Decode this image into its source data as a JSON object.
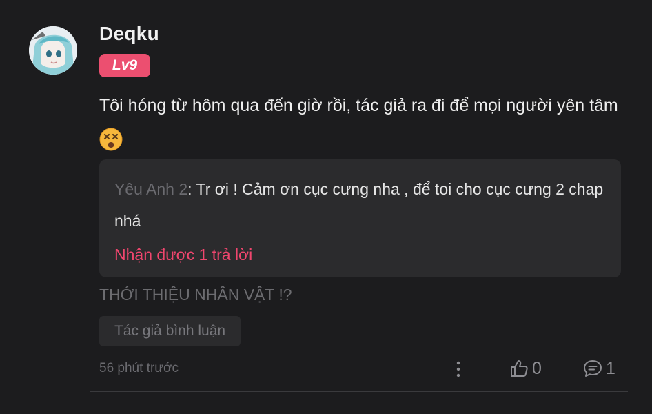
{
  "comment": {
    "username": "Deqku",
    "level": "Lv9",
    "text": "Tôi hóng từ hôm qua đến giờ rồi, tác giả ra đi để mọi người yên tâm",
    "emoji": "dizzy-face-emoji",
    "reply": {
      "author": "Yêu Anh 2",
      "separator": ": ",
      "text": "Tr ơi ! Cảm ơn cục cưng nha , để toi cho cục cưng 2 chap nhá",
      "count_label": "Nhận được 1 trả lời"
    },
    "extra_note": "THỚI THIỆU NHÂN VẬT !?",
    "tag": "Tác giả bình luận",
    "timestamp": "56 phút trước",
    "likes": "0",
    "replies": "1"
  },
  "colors": {
    "background": "#1c1c1e",
    "accent": "#ec4f70",
    "reply_link": "#f0466e",
    "muted": "#6b6b70",
    "panel": "#2b2b2d"
  },
  "icons": {
    "more": "vertical-dots-icon",
    "like": "thumbs-up-icon",
    "comment": "speech-bubble-icon"
  }
}
